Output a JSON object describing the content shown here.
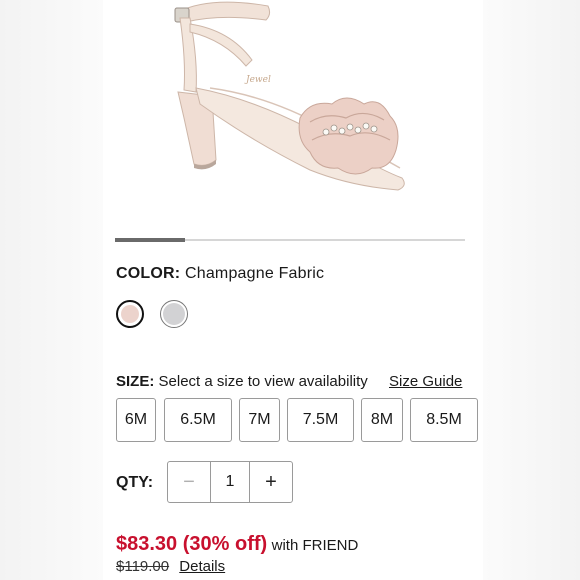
{
  "color": {
    "label": "COLOR:",
    "value": "Champagne Fabric",
    "swatches": [
      {
        "name": "Champagne Fabric",
        "hex": "#ecd3cc",
        "selected": true
      },
      {
        "name": "Silver",
        "hex": "#d2d2d4",
        "selected": false
      }
    ]
  },
  "carousel": {
    "progress_fraction": 0.2
  },
  "size": {
    "label": "SIZE:",
    "prompt": "Select a size to view availability",
    "guide_link": "Size Guide",
    "options": [
      "6M",
      "6.5M",
      "7M",
      "7.5M",
      "8M",
      "8.5M"
    ]
  },
  "quantity": {
    "label": "QTY:",
    "minus": "−",
    "value": "1",
    "plus": "+"
  },
  "price": {
    "sale": "$83.30 (30% off)",
    "promo": "with FRIEND",
    "original": "$119.00",
    "details_link": "Details"
  },
  "icons": {
    "product": "strappy-sandal-image"
  }
}
